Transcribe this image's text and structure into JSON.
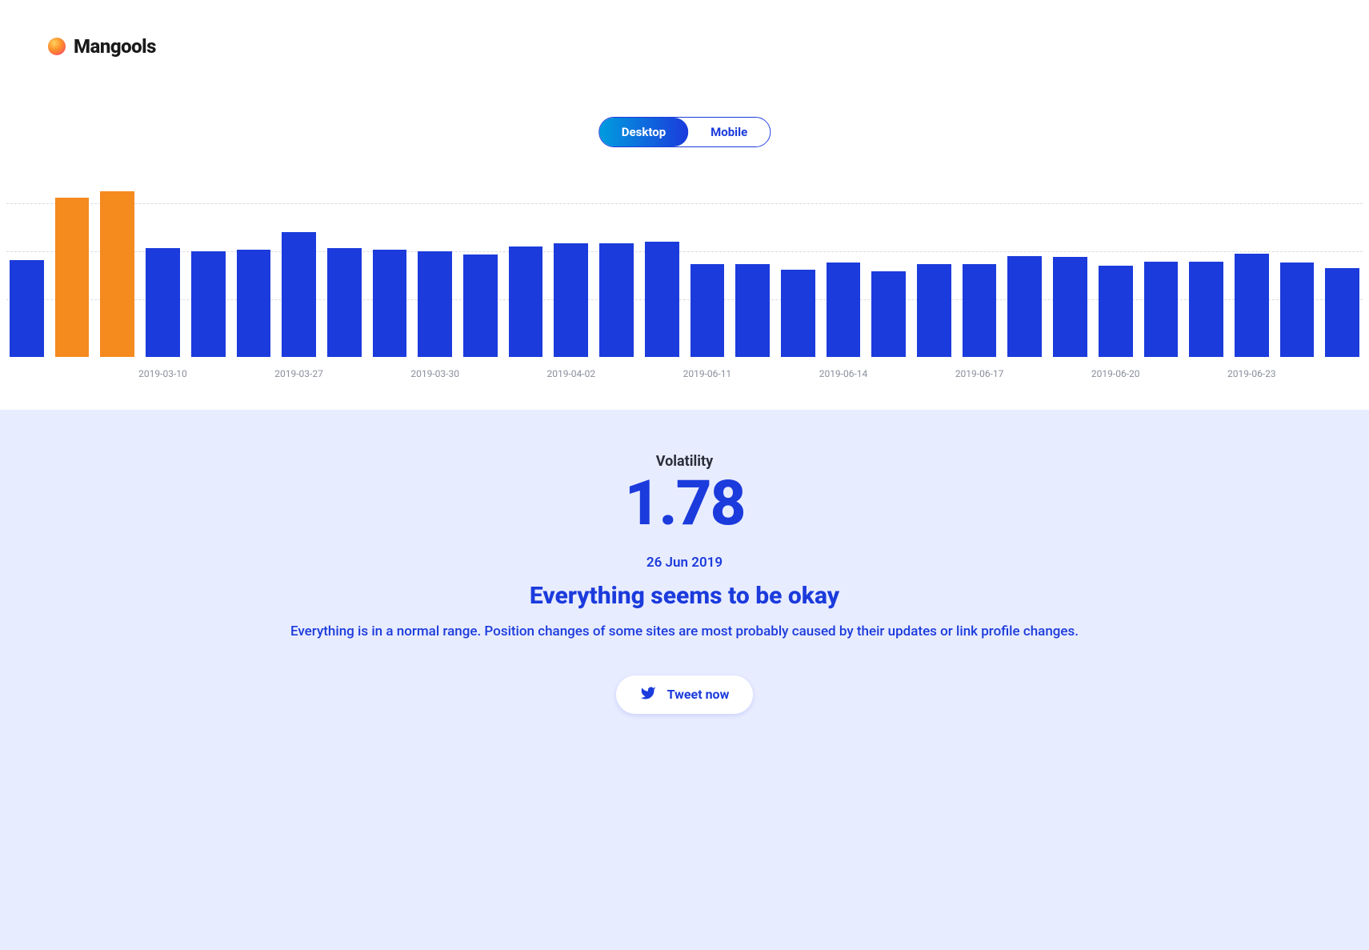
{
  "brand": {
    "name": "Mangools"
  },
  "toggle": {
    "desktop": "Desktop",
    "mobile": "Mobile",
    "active": "desktop"
  },
  "volatility": {
    "label": "Volatility",
    "value": "1.78",
    "date": "26 Jun 2019",
    "headline": "Everything seems to be okay",
    "description": "Everything is in a normal range. Position changes of some sites are most probably caused by their updates or link profile changes.",
    "tweet_label": "Tweet now"
  },
  "chart_data": {
    "type": "bar",
    "title": "",
    "xlabel": "",
    "ylabel": "",
    "ylim": [
      0,
      3.2
    ],
    "xtick_labels_shown": [
      {
        "index": 3,
        "label": "2019-03-10"
      },
      {
        "index": 6,
        "label": "2019-03-27"
      },
      {
        "index": 9,
        "label": "2019-03-30"
      },
      {
        "index": 12,
        "label": "2019-04-02"
      },
      {
        "index": 15,
        "label": "2019-06-11"
      },
      {
        "index": 18,
        "label": "2019-06-14"
      },
      {
        "index": 21,
        "label": "2019-06-17"
      },
      {
        "index": 24,
        "label": "2019-06-20"
      },
      {
        "index": 27,
        "label": "2019-06-23"
      }
    ],
    "series": [
      {
        "name": "Volatility",
        "color_default": "#1b3bdc",
        "color_highlight": "#f58a1f",
        "points": [
          {
            "value": 1.82,
            "highlight": false
          },
          {
            "value": 3.0,
            "highlight": true
          },
          {
            "value": 3.12,
            "highlight": true
          },
          {
            "value": 2.05,
            "highlight": false
          },
          {
            "value": 2.0,
            "highlight": false
          },
          {
            "value": 2.02,
            "highlight": false
          },
          {
            "value": 2.35,
            "highlight": false
          },
          {
            "value": 2.05,
            "highlight": false
          },
          {
            "value": 2.03,
            "highlight": false
          },
          {
            "value": 2.0,
            "highlight": false
          },
          {
            "value": 1.93,
            "highlight": false
          },
          {
            "value": 2.08,
            "highlight": false
          },
          {
            "value": 2.15,
            "highlight": false
          },
          {
            "value": 2.15,
            "highlight": false
          },
          {
            "value": 2.18,
            "highlight": false
          },
          {
            "value": 1.75,
            "highlight": false
          },
          {
            "value": 1.75,
            "highlight": false
          },
          {
            "value": 1.65,
            "highlight": false
          },
          {
            "value": 1.78,
            "highlight": false
          },
          {
            "value": 1.62,
            "highlight": false
          },
          {
            "value": 1.75,
            "highlight": false
          },
          {
            "value": 1.75,
            "highlight": false
          },
          {
            "value": 1.9,
            "highlight": false
          },
          {
            "value": 1.88,
            "highlight": false
          },
          {
            "value": 1.72,
            "highlight": false
          },
          {
            "value": 1.8,
            "highlight": false
          },
          {
            "value": 1.8,
            "highlight": false
          },
          {
            "value": 1.95,
            "highlight": false
          },
          {
            "value": 1.78,
            "highlight": false
          },
          {
            "value": 1.68,
            "highlight": false
          }
        ]
      }
    ]
  }
}
